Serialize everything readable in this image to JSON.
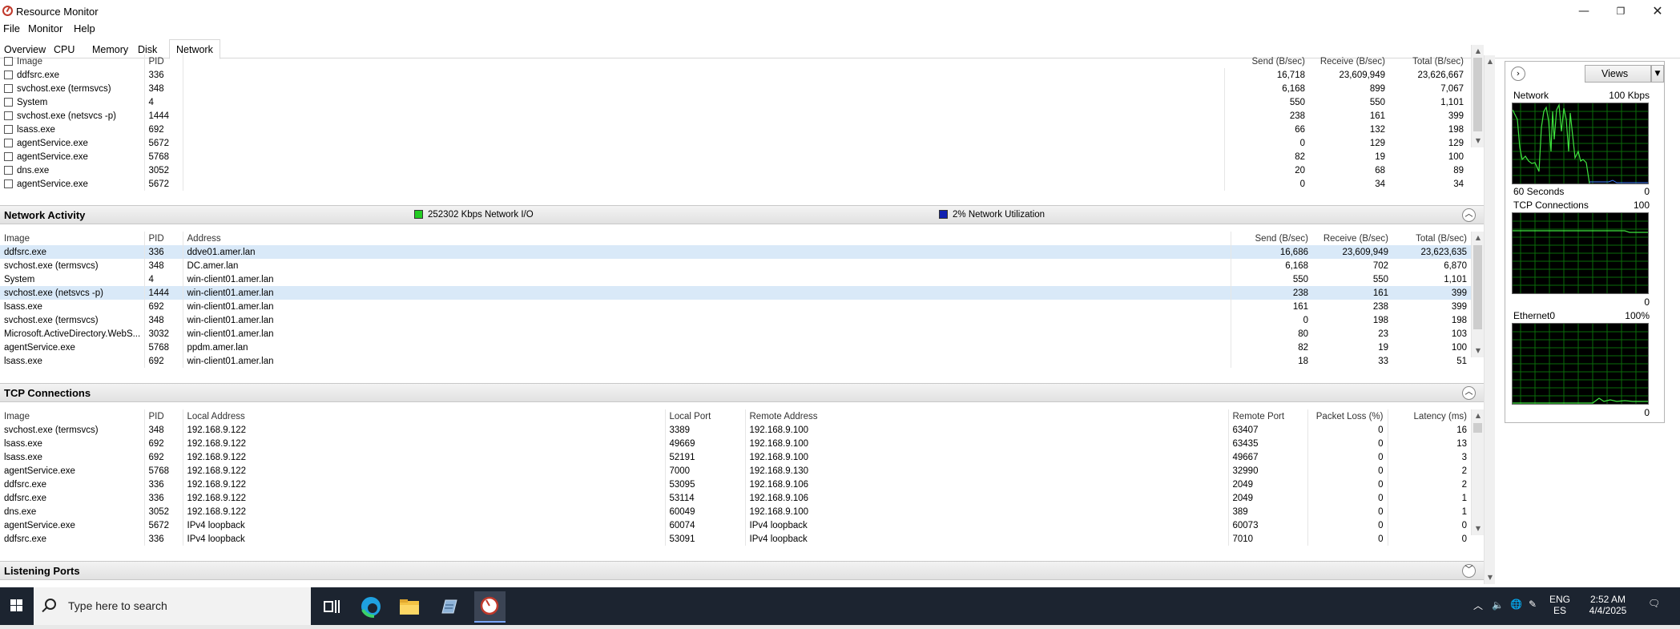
{
  "window": {
    "title": "Resource Monitor",
    "minimize": "—",
    "restore": "❐",
    "close": "✕"
  },
  "menu": [
    "File",
    "Monitor",
    "Help"
  ],
  "tabs": [
    "Overview",
    "CPU",
    "Memory",
    "Disk",
    "Network"
  ],
  "active_tab": "Network",
  "processes": {
    "columns": {
      "image": "Image",
      "pid": "PID",
      "send": "Send (B/sec)",
      "receive": "Receive (B/sec)",
      "total": "Total (B/sec)"
    },
    "rows": [
      [
        "ddfsrc.exe",
        "336",
        "16,718",
        "23,609,949",
        "23,626,667"
      ],
      [
        "svchost.exe (termsvcs)",
        "348",
        "6,168",
        "899",
        "7,067"
      ],
      [
        "System",
        "4",
        "550",
        "550",
        "1,101"
      ],
      [
        "svchost.exe (netsvcs -p)",
        "1444",
        "238",
        "161",
        "399"
      ],
      [
        "lsass.exe",
        "692",
        "66",
        "132",
        "198"
      ],
      [
        "agentService.exe",
        "5672",
        "0",
        "129",
        "129"
      ],
      [
        "agentService.exe",
        "5768",
        "82",
        "19",
        "100"
      ],
      [
        "dns.exe",
        "3052",
        "20",
        "68",
        "89"
      ],
      [
        "agentService.exe",
        "5672",
        "0",
        "34",
        "34"
      ]
    ]
  },
  "network_activity": {
    "title": "Network Activity",
    "io_label": "252302 Kbps Network I/O",
    "io_color": "#22cc22",
    "util_label": "2% Network Utilization",
    "util_color": "#1020b0",
    "columns": {
      "image": "Image",
      "pid": "PID",
      "address": "Address",
      "send": "Send (B/sec)",
      "receive": "Receive (B/sec)",
      "total": "Total (B/sec)"
    },
    "rows": [
      [
        "ddfsrc.exe",
        "336",
        "ddve01.amer.lan",
        "16,686",
        "23,609,949",
        "23,623,635"
      ],
      [
        "svchost.exe (termsvcs)",
        "348",
        "DC.amer.lan",
        "6,168",
        "702",
        "6,870"
      ],
      [
        "System",
        "4",
        "win-client01.amer.lan",
        "550",
        "550",
        "1,101"
      ],
      [
        "svchost.exe (netsvcs -p)",
        "1444",
        "win-client01.amer.lan",
        "238",
        "161",
        "399"
      ],
      [
        "lsass.exe",
        "692",
        "win-client01.amer.lan",
        "161",
        "238",
        "399"
      ],
      [
        "svchost.exe (termsvcs)",
        "348",
        "win-client01.amer.lan",
        "0",
        "198",
        "198"
      ],
      [
        "Microsoft.ActiveDirectory.WebS...",
        "3032",
        "win-client01.amer.lan",
        "80",
        "23",
        "103"
      ],
      [
        "agentService.exe",
        "5768",
        "ppdm.amer.lan",
        "82",
        "19",
        "100"
      ],
      [
        "lsass.exe",
        "692",
        "win-client01.amer.lan",
        "18",
        "33",
        "51"
      ]
    ],
    "highlighted_rows": [
      0,
      3
    ]
  },
  "tcp_connections": {
    "title": "TCP Connections",
    "columns": {
      "image": "Image",
      "pid": "PID",
      "local_address": "Local Address",
      "local_port": "Local Port",
      "remote_address": "Remote Address",
      "remote_port": "Remote Port",
      "packet_loss": "Packet Loss (%)",
      "latency": "Latency (ms)"
    },
    "rows": [
      [
        "svchost.exe (termsvcs)",
        "348",
        "192.168.9.122",
        "3389",
        "192.168.9.100",
        "63407",
        "0",
        "16"
      ],
      [
        "lsass.exe",
        "692",
        "192.168.9.122",
        "49669",
        "192.168.9.100",
        "63435",
        "0",
        "13"
      ],
      [
        "lsass.exe",
        "692",
        "192.168.9.122",
        "52191",
        "192.168.9.100",
        "49667",
        "0",
        "3"
      ],
      [
        "agentService.exe",
        "5768",
        "192.168.9.122",
        "7000",
        "192.168.9.130",
        "32990",
        "0",
        "2"
      ],
      [
        "ddfsrc.exe",
        "336",
        "192.168.9.122",
        "53095",
        "192.168.9.106",
        "2049",
        "0",
        "2"
      ],
      [
        "ddfsrc.exe",
        "336",
        "192.168.9.122",
        "53114",
        "192.168.9.106",
        "2049",
        "0",
        "1"
      ],
      [
        "dns.exe",
        "3052",
        "192.168.9.122",
        "60049",
        "192.168.9.100",
        "389",
        "0",
        "1"
      ],
      [
        "agentService.exe",
        "5672",
        "IPv4 loopback",
        "60074",
        "IPv4 loopback",
        "60073",
        "0",
        "0"
      ],
      [
        "ddfsrc.exe",
        "336",
        "IPv4 loopback",
        "53091",
        "IPv4 loopback",
        "7010",
        "0",
        "0"
      ]
    ]
  },
  "listening_ports": {
    "title": "Listening Ports"
  },
  "side_panel": {
    "views_label": "Views",
    "network_graph": {
      "title": "Network",
      "max": "100 Kbps",
      "span": "60 Seconds",
      "min": "0"
    },
    "tcp_graph": {
      "title": "TCP Connections",
      "max": "100",
      "min": "0"
    },
    "ethernet_graph": {
      "title": "Ethernet0",
      "max": "100%",
      "min": "0"
    }
  },
  "taskbar": {
    "search_placeholder": "Type here to search",
    "lang": "ENG",
    "locale": "ES",
    "time": "2:52 AM",
    "date": "4/4/2025"
  }
}
